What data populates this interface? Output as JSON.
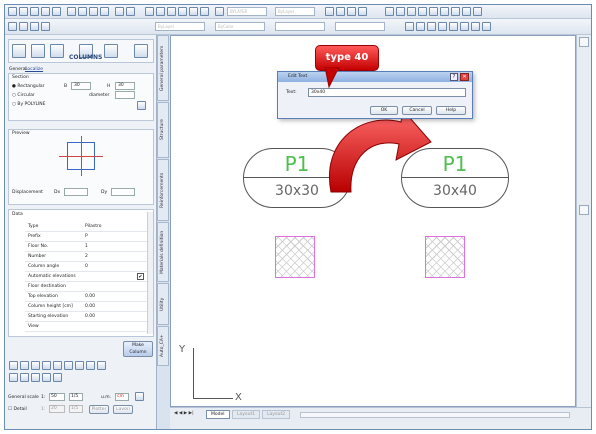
{
  "callout": "type 40",
  "panel": {
    "title": "COLUMNS",
    "tabs": [
      "General",
      "Localize"
    ],
    "section_label": "Section",
    "options": [
      "Rectangular",
      "Circular",
      "By POLYLINE"
    ],
    "b_label": "B",
    "b_value": "30",
    "h_label": "H",
    "h_value": "30",
    "diameter_label": "diameter",
    "preview_label": "Preview",
    "displacement_label": "Displacement",
    "dx_label": "Dx",
    "dy_label": "Dy",
    "data_label": "Data",
    "rows": [
      {
        "k": "Type",
        "v": "Pilastro"
      },
      {
        "k": "Prefix",
        "v": "P"
      },
      {
        "k": "Floor No.",
        "v": "1"
      },
      {
        "k": "Number",
        "v": "2"
      },
      {
        "k": "Column angle",
        "v": "0"
      },
      {
        "k": "Automatic elevations",
        "v": ""
      },
      {
        "k": "Floor destination",
        "v": ""
      },
      {
        "k": "Top elevation",
        "v": "0.00"
      },
      {
        "k": "Column height [cm]",
        "v": "0.00"
      },
      {
        "k": "Starting elevation",
        "v": "0.00"
      },
      {
        "k": "View",
        "v": ""
      }
    ],
    "make_column": "Make Column",
    "scale_label": "General scale",
    "scale_a": "1:",
    "scale_b": "50",
    "scale_c": "1/5",
    "um_label": "u.m.",
    "um_value": "cm",
    "detail_label": "Detail",
    "detail_a": "1:",
    "detail_b": "20",
    "detail_c": "1/5",
    "detail_btn1": "Plotter",
    "detail_btn2": "Lavori"
  },
  "side_tabs": [
    "General parameters",
    "Structure",
    "Reinforcements",
    "Materials definition",
    "Utility",
    "Auto_CA+"
  ],
  "dialog": {
    "title": "Edit Text",
    "text_label": "Text:",
    "text_value": "30x40",
    "ok": "OK",
    "cancel": "Cancel",
    "help": "Help"
  },
  "labels": {
    "p1_left_top": "P1",
    "p1_left_bot": "30x30",
    "p1_right_top": "P1",
    "p1_right_bot": "30x40"
  },
  "axes": {
    "y": "Y",
    "x": "X"
  },
  "tabs": [
    "Model",
    "Layout1",
    "Layout2"
  ],
  "toolbar": {
    "combo1": "BYLAYER",
    "combo2": "ByLayer",
    "combo3": "ByLayer",
    "combo4": "ByColor"
  }
}
